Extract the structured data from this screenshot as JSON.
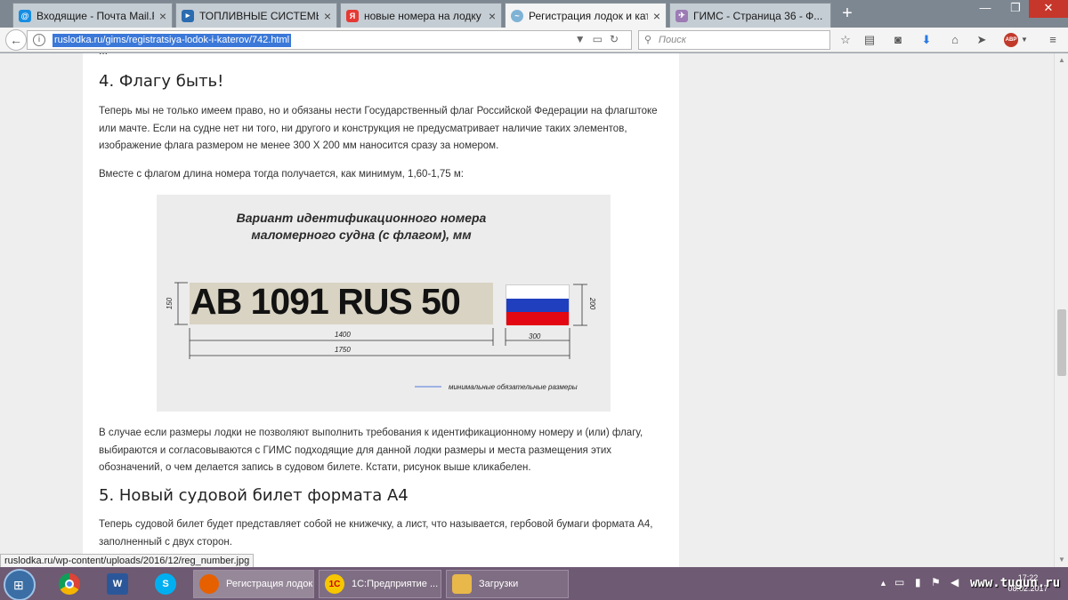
{
  "browser": {
    "tabs": [
      {
        "label": "Входящие - Почта Mail.Ru",
        "icon": "mail-icon",
        "color": "#168de2"
      },
      {
        "label": "ТОПЛИВНЫЕ СИСТЕМЫ ...",
        "icon": "site-icon",
        "color": "#2b6cb0"
      },
      {
        "label": "новые номера на лодку ...",
        "icon": "yandex-icon",
        "color": "#e53935"
      },
      {
        "label": "Регистрация лодок и кат...",
        "icon": "ruslodka-icon",
        "color": "#7fb3d5"
      },
      {
        "label": "ГИМС - Страница 36 - Ф...",
        "icon": "forum-icon",
        "color": "#9c7bb5"
      }
    ],
    "new_tab": "+",
    "url": "ruslodka.ru/gims/registratsiya-lodok-i-katerov/742.html",
    "search_placeholder": "Поиск",
    "abp_label": "ABP",
    "status_url": "ruslodka.ru/wp-content/uploads/2016/12/reg_number.jpg"
  },
  "article": {
    "cutoff_text": "...",
    "section4_title": "4. Флагу быть!",
    "section4_p1": "Теперь мы не только имеем право, но и обязаны нести Государственный флаг Российской Федерации на флагштоке или мачте. Если на судне нет ни того, ни другого и конструкция не предусматривает наличие таких элементов, изображение флага размером не менее 300 Х 200 мм наносится сразу за номером.",
    "section4_p2": "Вместе с флагом длина номера тогда получается, как минимум, 1,60-1,75 м:",
    "figure": {
      "title_line1": "Вариант идентификационного номера",
      "title_line2": "маломерного судна (с флагом), мм",
      "plate_number": "AB 1091 RUS 50",
      "dim_height": "150",
      "dim_flag_height": "200",
      "dim_plate_width": "1400",
      "dim_flag_width": "300",
      "dim_total_width": "1750",
      "legend": "минимальные обязательные размеры",
      "flag_colors": [
        "#ffffff",
        "#1f3fbf",
        "#e30613"
      ]
    },
    "section4_p3": "В случае если размеры лодки не позволяют выполнить требования к идентификационному номеру и (или) флагу, выбираются и согласовываются с ГИМС подходящие для данной лодки размеры и места размещения этих обозначений, о чем делается запись в судовом билете. Кстати, рисунок выше кликабелен.",
    "section5_title": "5. Новый судовой билет формата А4",
    "section5_p1": "Теперь судовой билет будет представляет собой не книжечку, а лист, что называется, гербовой бумаги формата А4, заполненный с двух сторон."
  },
  "taskbar": {
    "pinned": [
      {
        "name": "chrome-icon",
        "label": "",
        "color": "#db4437"
      },
      {
        "name": "word-icon",
        "label": "W",
        "color": "#2b579a"
      },
      {
        "name": "skype-icon",
        "label": "S",
        "color": "#00aff0"
      }
    ],
    "tasks": [
      {
        "label": "Регистрация лодок ...",
        "icon": "firefox-icon",
        "color": "#e66000",
        "active": true
      },
      {
        "label": "1С:Предприятие ...",
        "icon": "1c-icon",
        "color": "#f7c600",
        "iconText": "1С",
        "active": false
      },
      {
        "label": "Загрузки",
        "icon": "folder-icon",
        "color": "#e8b84a",
        "active": false
      }
    ],
    "clock_time": "17:22",
    "clock_date": "08.02.2017",
    "watermark": "www.tugun.ru"
  }
}
